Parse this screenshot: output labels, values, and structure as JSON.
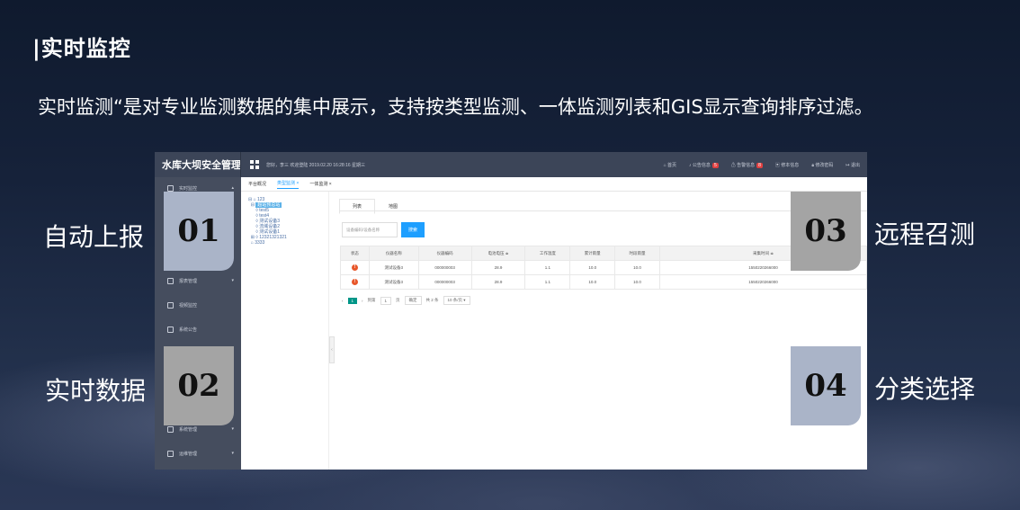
{
  "slide": {
    "title": "|实时监控",
    "subtitle": "实时监测“是对专业监测数据的集中展示，支持按类型监测、一体监测列表和GIS显示查询排序过滤。"
  },
  "features": [
    {
      "number": "01",
      "label": "自动上报"
    },
    {
      "number": "02",
      "label": "实时数据"
    },
    {
      "number": "03",
      "label": "远程召测"
    },
    {
      "number": "04",
      "label": "分类选择"
    }
  ],
  "colors": {
    "badge_blue": "#aab4c8",
    "badge_gray": "#a4a4a4",
    "primary": "#1e9fff",
    "warn": "#e8572a"
  },
  "app": {
    "brand": "水库大坝安全管理系统",
    "welcome": "您好，李三 欢迎登陆  2019.02.20 16:28:16 星期三",
    "top_nav": [
      {
        "icon": "home-icon",
        "label": "首页"
      },
      {
        "icon": "bell-icon",
        "label": "公告信息",
        "badge": "5"
      },
      {
        "icon": "alert-icon",
        "label": "告警信息",
        "badge": "8"
      },
      {
        "icon": "monitor-icon",
        "label": "修本信息"
      },
      {
        "icon": "lock-icon",
        "label": "修改密码"
      },
      {
        "icon": "logout-icon",
        "label": "退出"
      }
    ],
    "sidebar": [
      {
        "icon": "monitor-icon",
        "label": "实时监控"
      },
      {
        "icon": "chart-icon",
        "label": "报表管理"
      },
      {
        "icon": "building-icon",
        "label": "视频监控"
      },
      {
        "icon": "notice-icon",
        "label": "系统公告"
      },
      {
        "icon": "settings-icon",
        "label": "系统管理"
      },
      {
        "icon": "gear-icon",
        "label": "运维管理"
      }
    ],
    "tabs": [
      "平台概况",
      "类型监测",
      "一体监测"
    ],
    "tree": [
      "123",
      "超站预总站",
      "test5",
      "test4",
      "测试设备3",
      "流域设备2",
      "测试设备1",
      "12321321321",
      "3333"
    ],
    "subtabs": [
      "列表",
      "地图"
    ],
    "search_placeholder": "设备编码/设备名称",
    "search_button": "搜索",
    "table": {
      "headers": [
        "状态",
        "仪器名称",
        "仪器编码",
        "电池电压 ≑",
        "工作温度",
        "累计雨量",
        "时段雨量",
        "采集时间 ≑"
      ],
      "rows": [
        [
          "!",
          "测试设备3",
          "000000003",
          "28.9",
          "1.1",
          "10.0",
          "10.0",
          "1550220266000"
        ],
        [
          "!",
          "测试设备3",
          "000000003",
          "28.9",
          "1.1",
          "10.0",
          "10.0",
          "1550220266000"
        ]
      ]
    },
    "pager": {
      "current": "1",
      "goto_label": "到第",
      "page_input": "1",
      "page_unit": "页",
      "confirm": "确定",
      "total": "共 2 条",
      "per_page": "10 条/页 ▾"
    }
  }
}
